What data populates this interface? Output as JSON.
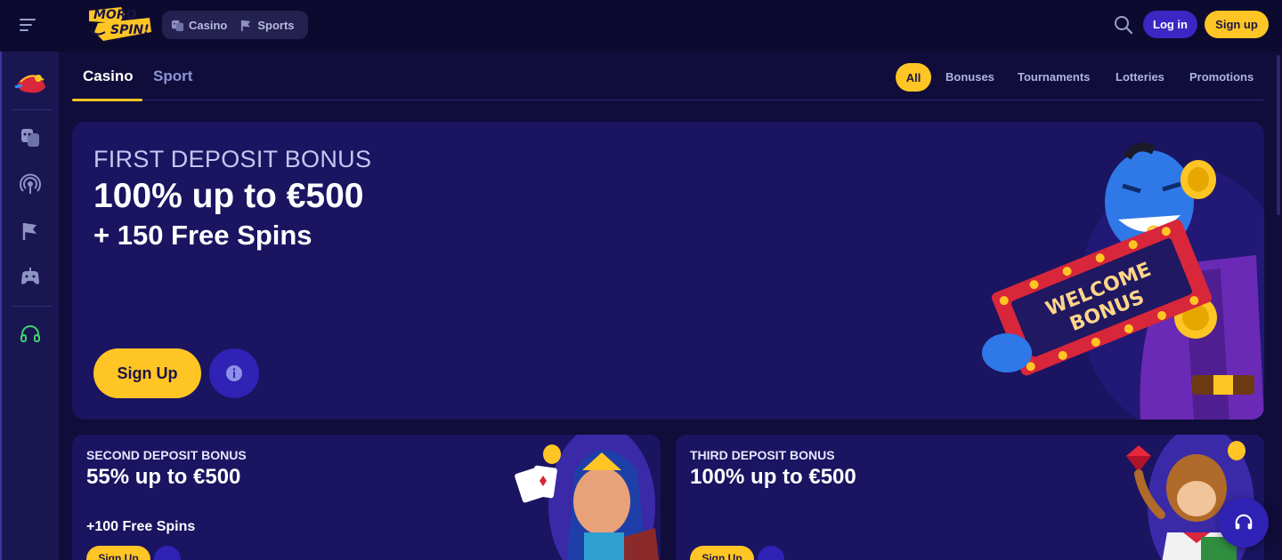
{
  "header": {
    "logo_text_top": "MORO",
    "logo_text_bottom": "SPIN!",
    "nav": [
      {
        "label": "Casino",
        "icon": "casino-icon"
      },
      {
        "label": "Sports",
        "icon": "sports-flag-icon"
      }
    ],
    "login_label": "Log in",
    "signup_label": "Sign up"
  },
  "sidebar": {
    "items": [
      {
        "icon": "magic-lamp-icon"
      },
      {
        "icon": "casino-masks-icon"
      },
      {
        "icon": "live-broadcast-icon"
      },
      {
        "icon": "sports-flag-icon"
      },
      {
        "icon": "gamepad-icon"
      },
      {
        "icon": "headset-icon"
      }
    ]
  },
  "subnav": {
    "tabs": [
      "Casino",
      "Sport"
    ],
    "active_tab": "Casino",
    "filters": [
      "All",
      "Bonuses",
      "Tournaments",
      "Lotteries",
      "Promotions"
    ],
    "active_filter": "All"
  },
  "hero": {
    "kicker": "FIRST DEPOSIT BONUS",
    "title": "100% up to €500",
    "subtitle": "+ 150 Free Spins",
    "button_label": "Sign Up",
    "sign_line1": "WELCOME",
    "sign_line2": "BONUS"
  },
  "cards": [
    {
      "kicker": "SECOND DEPOSIT BONUS",
      "title": "55% up to €500",
      "subtitle": "+100 Free Spins",
      "button_label": "Sign Up"
    },
    {
      "kicker": "THIRD DEPOSIT BONUS",
      "title": "100% up to €500",
      "subtitle": "",
      "button_label": "Sign Up"
    }
  ],
  "colors": {
    "accent": "#ffc524",
    "primary_button": "#3c27c4",
    "background": "#110d3a",
    "card": "#1b1461",
    "sidebar": "#1a1652"
  }
}
